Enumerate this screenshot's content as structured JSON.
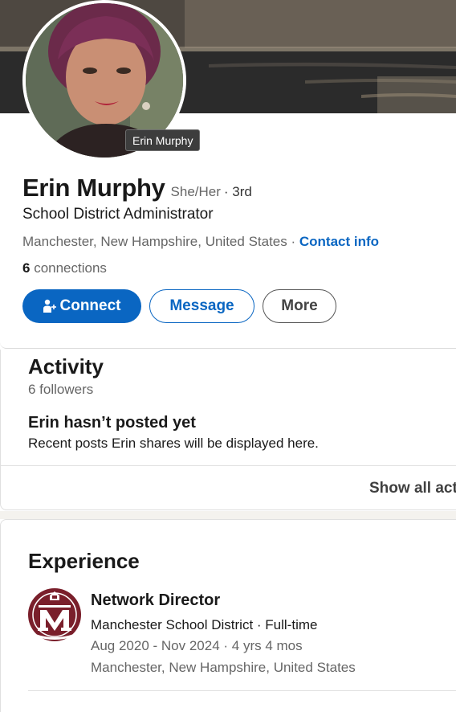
{
  "profile": {
    "avatar_tooltip": "Erin Murphy",
    "name": "Erin Murphy",
    "pronouns": "She/Her",
    "degree": "· 3rd",
    "headline": "School District Administrator",
    "location": "Manchester, New Hampshire, United States",
    "location_separator": " · ",
    "contact_info_label": "Contact info",
    "connections_count": "6",
    "connections_label": " connections",
    "actions": {
      "connect_label": "Connect",
      "message_label": "Message",
      "more_label": "More"
    },
    "icons": {
      "connect": "add-person-icon",
      "avatar": "profile-photo",
      "cover": "cover-photo"
    }
  },
  "activity": {
    "title": "Activity",
    "followers": "6 followers",
    "empty_title": "Erin hasn’t posted yet",
    "empty_subtitle": "Recent posts Erin shares will be displayed here.",
    "show_all_label": "Show all activity"
  },
  "experience": {
    "title": "Experience",
    "items": [
      {
        "title": "Network Director",
        "company": "Manchester School District · Full-time",
        "dates": "Aug 2020 - Nov 2024 · 4 yrs 4 mos",
        "location": "Manchester, New Hampshire, United States",
        "logo_icon": "school-district-logo-icon"
      }
    ]
  },
  "colors": {
    "brand_blue": "#0a66c2",
    "logo_maroon": "#7a1f2b"
  }
}
